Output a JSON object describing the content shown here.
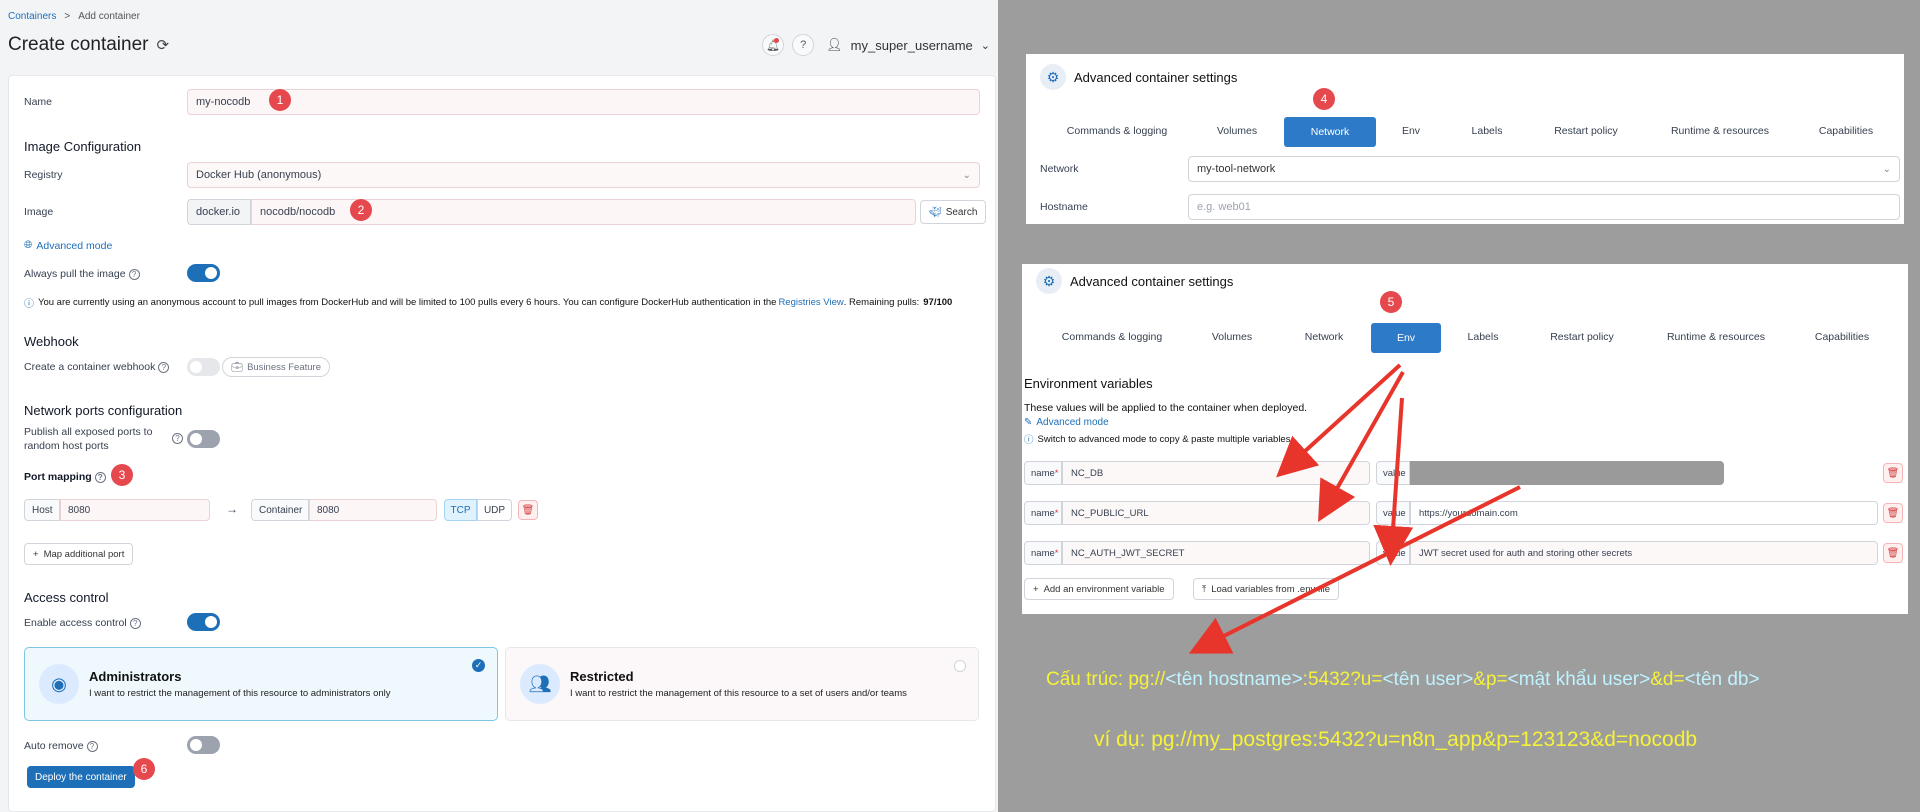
{
  "breadcrumb": {
    "root": "Containers",
    "separator": ">",
    "current": "Add container"
  },
  "page": {
    "title": "Create container",
    "username": "my_super_username"
  },
  "form": {
    "name_label": "Name",
    "name_value": "my-nocodb",
    "image_config_title": "Image Configuration",
    "registry_label": "Registry",
    "registry_value": "Docker Hub (anonymous)",
    "image_label": "Image",
    "image_prefix": "docker.io",
    "image_value": "nocodb/nocodb",
    "search_label": "Search",
    "advanced_mode": "Advanced mode",
    "always_pull_label": "Always pull the image",
    "info_text": "You are currently using an anonymous account to pull images from DockerHub and will be limited to 100 pulls every 6 hours. You can configure DockerHub authentication in the",
    "info_link": "Registries View",
    "info_tail": ". Remaining pulls:",
    "remaining_pulls": "97/100",
    "webhook_title": "Webhook",
    "webhook_label": "Create a container webhook",
    "business_feature": "Business Feature",
    "network_ports_title": "Network ports configuration",
    "publish_label_1": "Publish all exposed ports to",
    "publish_label_2": "random host ports",
    "port_mapping_label": "Port mapping",
    "host_label": "Host",
    "host_value": "8080",
    "container_label": "Container",
    "container_value": "8080",
    "tcp": "TCP",
    "udp": "UDP",
    "map_port_btn": "Map additional port",
    "access_control_title": "Access control",
    "enable_access_label": "Enable access control",
    "admins_title": "Administrators",
    "admins_desc": "I want to restrict the management of this resource to administrators only",
    "restricted_title": "Restricted",
    "restricted_desc": "I want to restrict the management of this resource to a set of users and/or teams",
    "auto_remove_label": "Auto remove",
    "deploy_btn": "Deploy the container"
  },
  "badges": [
    "1",
    "2",
    "3",
    "4",
    "5",
    "6"
  ],
  "network_panel": {
    "header": "Advanced container settings",
    "tabs": [
      "Commands & logging",
      "Volumes",
      "Network",
      "Env",
      "Labels",
      "Restart policy",
      "Runtime & resources",
      "Capabilities"
    ],
    "active_tab": "Network",
    "network_label": "Network",
    "network_value": "my-tool-network",
    "hostname_label": "Hostname",
    "hostname_placeholder": "e.g. web01"
  },
  "env_panel": {
    "header": "Advanced container settings",
    "tabs": [
      "Commands & logging",
      "Volumes",
      "Network",
      "Env",
      "Labels",
      "Restart policy",
      "Runtime & resources",
      "Capabilities"
    ],
    "active_tab": "Env",
    "section_title": "Environment variables",
    "desc": "These values will be applied to the container when deployed.",
    "advanced_mode": "Advanced mode",
    "info": "Switch to advanced mode to copy & paste multiple variables",
    "name_key": "name",
    "value_key": "value",
    "rows": [
      {
        "name": "NC_DB",
        "value": ""
      },
      {
        "name": "NC_PUBLIC_URL",
        "value": "https://yourdomain.com"
      },
      {
        "name": "NC_AUTH_JWT_SECRET",
        "value": "JWT secret used for auth and storing other secrets"
      }
    ],
    "add_btn": "Add an environment variable",
    "load_btn": "Load variables from .env file"
  },
  "annotation": {
    "structure_label": "Cấu trúc: pg://",
    "structure_hostname": "<tên hostname>",
    "structure_port": ":5432?u=",
    "structure_user": "<tên user>",
    "structure_p": "&p=",
    "structure_pass": "<mật khẩu user>",
    "structure_d": "&d=",
    "structure_db": "<tên db>",
    "example": "ví dụ: pg://my_postgres:5432?u=n8n_app&p=123123&d=nocodb"
  },
  "colors": {
    "primary": "#1d6fb8",
    "badge_red": "#e5484d",
    "annotation_yellow": "#f6f23a",
    "annotation_cyan": "#bff3ff",
    "arrow_red": "#e8352c"
  }
}
